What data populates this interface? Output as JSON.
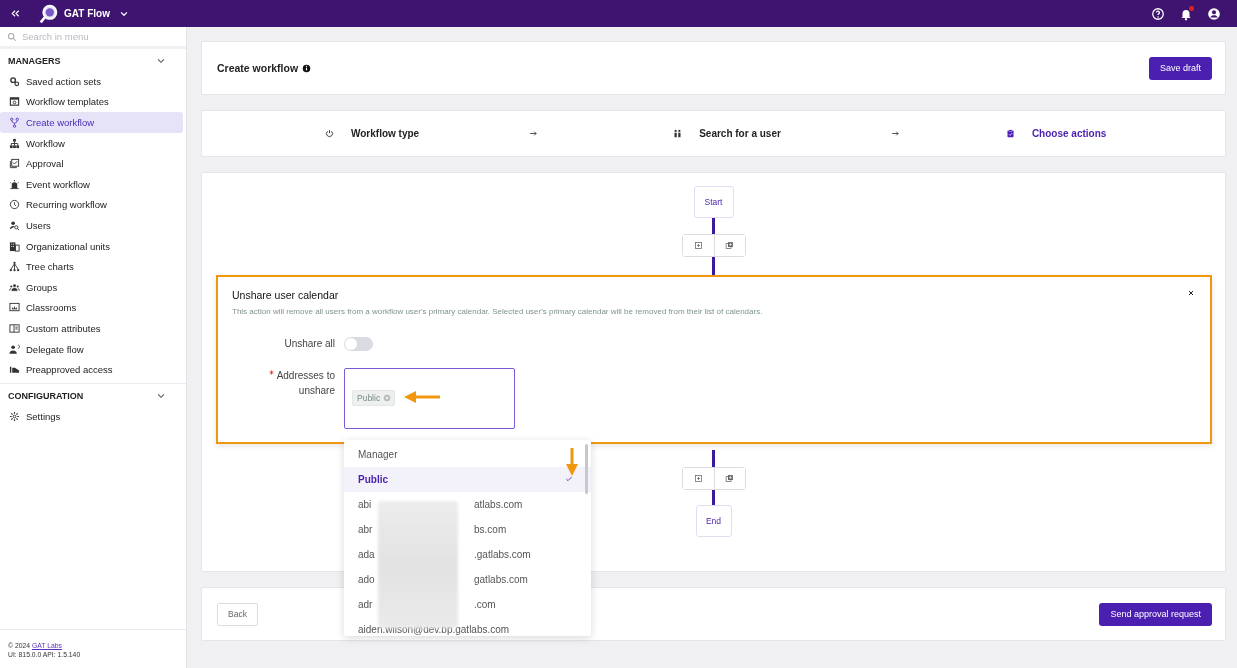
{
  "topbar": {
    "app_name": "GAT Flow",
    "notification_unread": true
  },
  "sidebar": {
    "search_placeholder": "Search in menu",
    "sections": [
      {
        "title": "MANAGERS",
        "expanded": true,
        "items": [
          {
            "label": "Saved action sets",
            "selected": false
          },
          {
            "label": "Workflow templates",
            "selected": false
          },
          {
            "label": "Create workflow",
            "selected": true
          },
          {
            "label": "Workflow",
            "selected": false
          },
          {
            "label": "Approval",
            "selected": false
          },
          {
            "label": "Event workflow",
            "selected": false
          },
          {
            "label": "Recurring workflow",
            "selected": false
          },
          {
            "label": "Users",
            "selected": false
          },
          {
            "label": "Organizational units",
            "selected": false
          },
          {
            "label": "Tree charts",
            "selected": false
          },
          {
            "label": "Groups",
            "selected": false
          },
          {
            "label": "Classrooms",
            "selected": false
          },
          {
            "label": "Custom attributes",
            "selected": false
          },
          {
            "label": "Delegate flow",
            "selected": false
          },
          {
            "label": "Preapproved access",
            "selected": false
          }
        ]
      },
      {
        "title": "CONFIGURATION",
        "expanded": true,
        "items": [
          {
            "label": "Settings",
            "selected": false
          }
        ]
      }
    ],
    "footer": {
      "copyright": "© 2024",
      "link": "GAT Labs",
      "version": "UI: 815.0.0 API: 1.5.140"
    }
  },
  "header": {
    "title": "Create workflow",
    "button": "Save draft"
  },
  "steps": [
    {
      "label": "Workflow type",
      "selected": false
    },
    {
      "label": "Search for a user",
      "selected": false
    },
    {
      "label": "Choose actions",
      "selected": true
    }
  ],
  "flow": {
    "start": "Start",
    "end": "End"
  },
  "action_panel": {
    "title": "Unshare user calendar",
    "description": "This action will remove all users from a workflow user's primary calendar. Selected user's primary calendar will be removed from their list of calendars.",
    "unshare_all": {
      "label": "Unshare all",
      "on": false
    },
    "addresses": {
      "label": "Addresses to unshare",
      "required": true,
      "tags": [
        "Public"
      ]
    }
  },
  "dropdown": {
    "options": [
      {
        "kind": "plain",
        "label": "Manager",
        "selected": false
      },
      {
        "kind": "plain",
        "label": "Public",
        "selected": true
      },
      {
        "kind": "redacted",
        "label_start": "abi",
        "label_end": "atlabs.com",
        "selected": false
      },
      {
        "kind": "redacted",
        "label_start": "abr",
        "label_end": "bs.com",
        "selected": false
      },
      {
        "kind": "redacted",
        "label_start": "ada",
        "label_end": ".gatlabs.com",
        "selected": false
      },
      {
        "kind": "redacted",
        "label_start": "ado",
        "label_end": "gatlabs.com",
        "selected": false
      },
      {
        "kind": "redacted",
        "label_start": "adr",
        "label_end": ".com",
        "selected": false
      },
      {
        "kind": "plain",
        "label": "aiden.wilson@dev.bp.gatlabs.com",
        "selected": false
      }
    ]
  },
  "footer_bar": {
    "back": "Back",
    "submit": "Send approval request"
  }
}
